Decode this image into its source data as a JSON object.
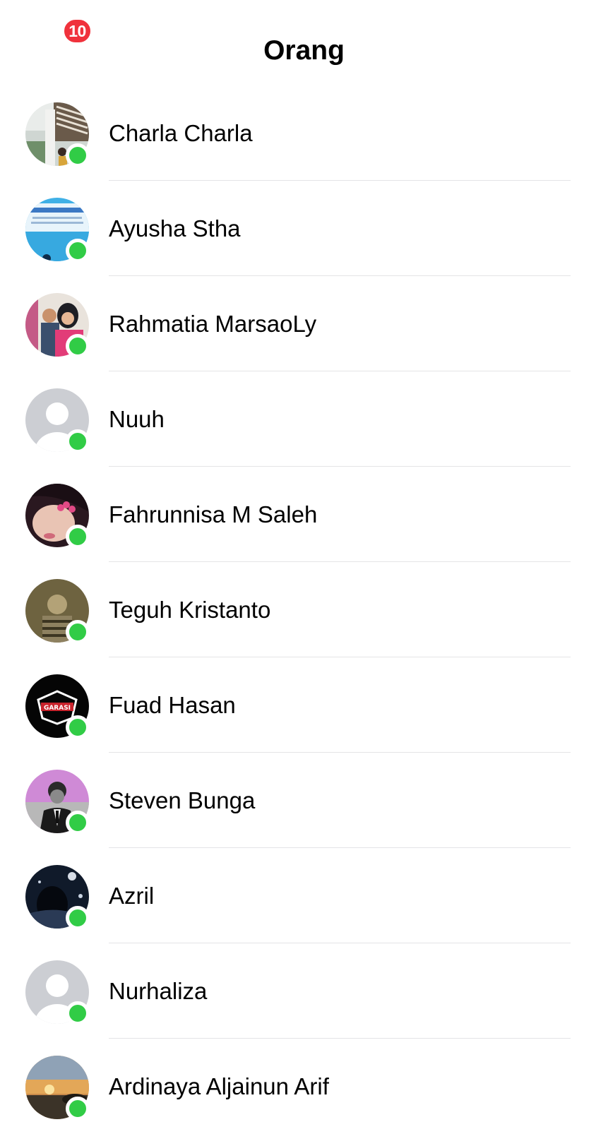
{
  "header": {
    "badge_count": "10",
    "title": "Orang"
  },
  "colors": {
    "badge": "#f0323c",
    "online_dot": "#31cc46",
    "divider": "#e4e4e6"
  },
  "people": [
    {
      "name": "Charla Charla",
      "online": true,
      "avatar": "photo-building"
    },
    {
      "name": "Ayusha Stha",
      "online": true,
      "avatar": "photo-banner-ybo-trade-nepal"
    },
    {
      "name": "Rahmatia MarsaoLy",
      "online": true,
      "avatar": "photo-couple"
    },
    {
      "name": "Nuuh",
      "online": true,
      "avatar": "default-silhouette"
    },
    {
      "name": "Fahrunnisa M Saleh",
      "online": true,
      "avatar": "photo-selfie"
    },
    {
      "name": "Teguh Kristanto",
      "online": true,
      "avatar": "photo-sepia-portrait"
    },
    {
      "name": "Fuad Hasan",
      "online": true,
      "avatar": "logo-garasi"
    },
    {
      "name": "Steven Bunga",
      "online": true,
      "avatar": "photo-suit-portrait"
    },
    {
      "name": "Azril",
      "online": true,
      "avatar": "photo-dark-night"
    },
    {
      "name": "Nurhaliza",
      "online": true,
      "avatar": "default-silhouette"
    },
    {
      "name": "Ardinaya Aljainun Arif",
      "online": true,
      "avatar": "photo-sunset"
    }
  ],
  "avatar_logo_text": "GARASI"
}
